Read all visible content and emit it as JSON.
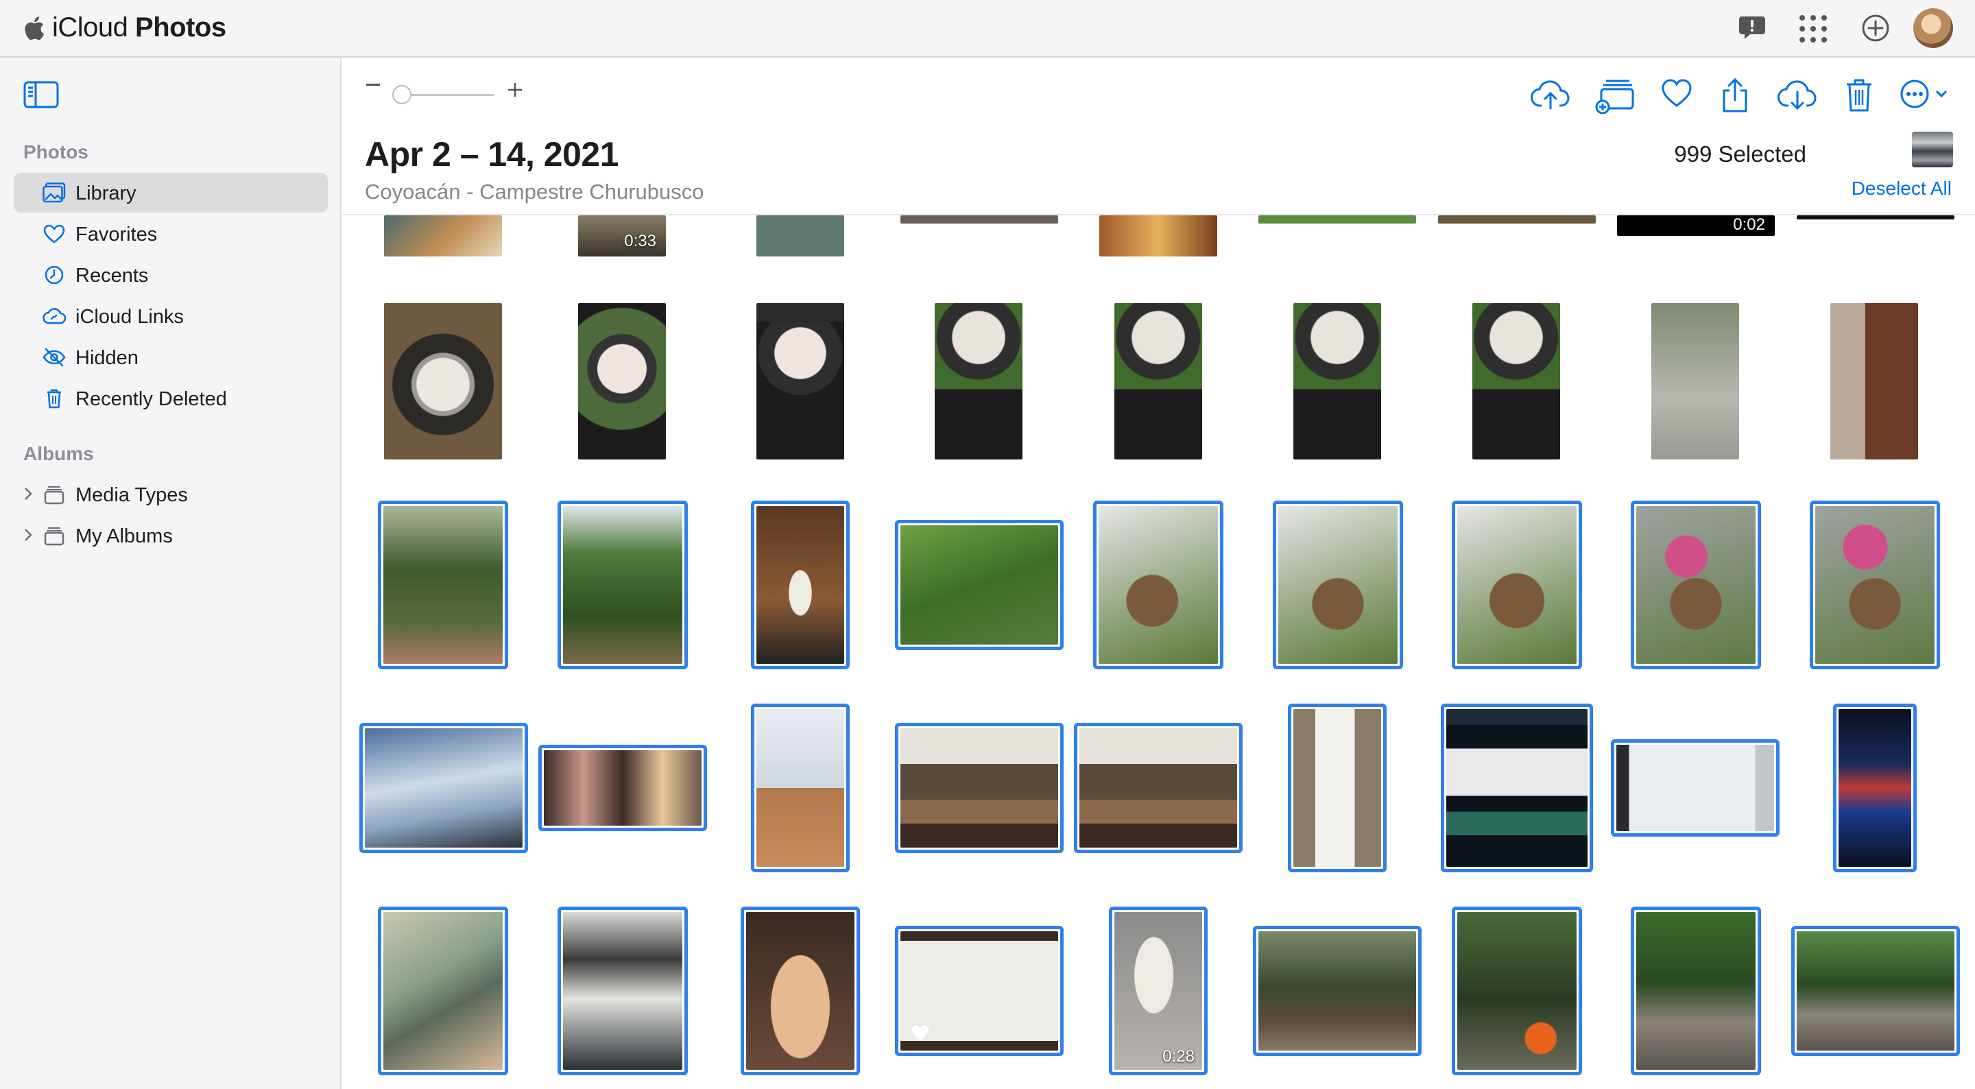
{
  "header": {
    "app_name_light": "iCloud ",
    "app_name_bold": "Photos",
    "icons": [
      "feedback-icon",
      "app-grid-icon",
      "add-icon",
      "account-avatar"
    ]
  },
  "sidebar": {
    "photos_section": "Photos",
    "items": [
      {
        "label": "Library",
        "icon": "library-icon",
        "active": true
      },
      {
        "label": "Favorites",
        "icon": "heart-icon"
      },
      {
        "label": "Recents",
        "icon": "clock-icon"
      },
      {
        "label": "iCloud Links",
        "icon": "cloud-link-icon"
      },
      {
        "label": "Hidden",
        "icon": "eye-slash-icon"
      },
      {
        "label": "Recently Deleted",
        "icon": "trash-icon"
      }
    ],
    "albums_section": "Albums",
    "albums": [
      {
        "label": "Media Types",
        "icon": "album-folder-icon"
      },
      {
        "label": "My Albums",
        "icon": "album-folder-icon"
      }
    ]
  },
  "toolbar": {
    "zoom_level": 0,
    "icons": [
      "upload-icon",
      "add-to-album-icon",
      "favorite-icon",
      "share-icon",
      "download-icon",
      "delete-icon",
      "more-icon"
    ]
  },
  "moment": {
    "title": "Apr 2 – 14, 2021",
    "location": "Coyoacán - Campestre Churubusco",
    "selected_count": "999 Selected",
    "deselect_label": "Deselect All"
  },
  "videos": {
    "dur1": "0:33",
    "dur2": "0:02",
    "dur3": "0:28"
  },
  "colors": {
    "accent": "#0071e3",
    "selection": "#2f80ed",
    "sidebar_bg": "#f5f5f7"
  }
}
